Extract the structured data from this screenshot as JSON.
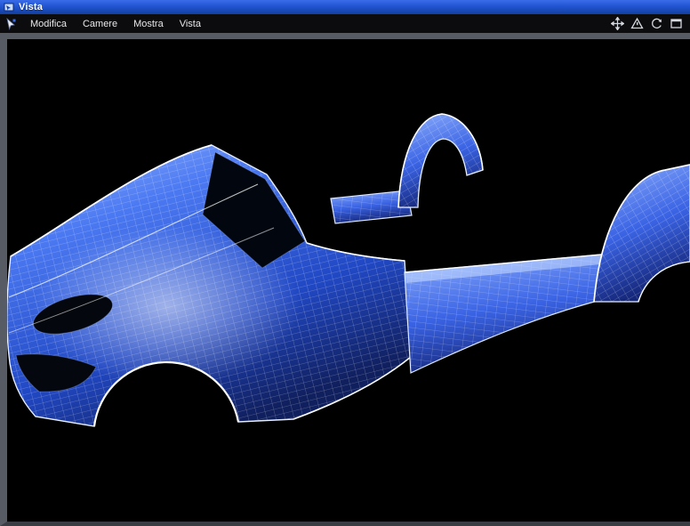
{
  "window": {
    "title": "Vista"
  },
  "menubar": {
    "items": [
      "Modifica",
      "Camere",
      "Mostra",
      "Vista"
    ],
    "left_icon": "select-tool-icon",
    "right_icons": [
      "pan-icon",
      "warning-triangle-icon",
      "rotate-view-icon",
      "maximize-view-icon"
    ]
  },
  "viewport": {
    "model": "car-body-wireframe-mesh",
    "colors": {
      "titlebar_blue": "#2154d2",
      "menubar_bg": "#0c0c0e",
      "frame_gray": "#575c64",
      "viewport_bg": "#000000",
      "body_surface_blue": "#3d6ef0",
      "wireframe_white": "#ffffff"
    }
  }
}
